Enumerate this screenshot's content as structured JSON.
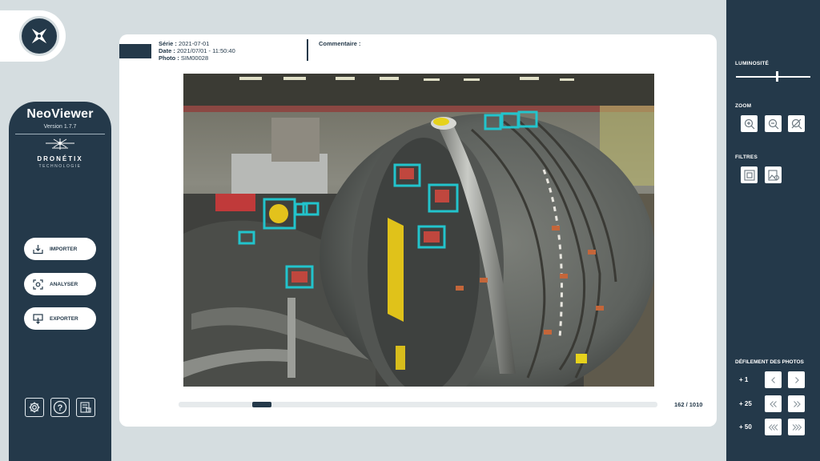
{
  "app": {
    "name": "NeoViewer",
    "version": "Version 1.7.7",
    "brand": "DRONÉTIX",
    "brand_sub": "TECHNOLOGIE"
  },
  "sidebar": {
    "buttons": [
      {
        "label": "IMPORTER",
        "icon": "import-icon"
      },
      {
        "label": "ANALYSER",
        "icon": "scan-icon"
      },
      {
        "label": "EXPORTER",
        "icon": "export-icon"
      }
    ],
    "utility_icons": [
      "settings-icon",
      "help-icon",
      "report-icon"
    ]
  },
  "photo_info": {
    "serie_label": "Série :",
    "serie_value": "2021-07-01",
    "date_label": "Date :",
    "date_value": "2021/07/01 - 11:50:40",
    "photo_label": "Photo :",
    "photo_value": "SIM00028",
    "comment_label": "Commentaire :"
  },
  "viewer": {
    "counter": "162 / 1010",
    "current": 162,
    "total": 1010,
    "detection_color": "#22c4cc",
    "detections_count": 11
  },
  "right_panel": {
    "luminosity_label": "LUMINOSITÉ",
    "luminosity_level": 0.54,
    "zoom_label": "ZOOM",
    "zoom_icons": [
      "zoom-in-icon",
      "zoom-out-icon",
      "zoom-reset-icon"
    ],
    "filters_label": "FILTRES",
    "filter_icons": [
      "filter-frame-icon",
      "filter-image-icon"
    ],
    "scroll_label": "DÉFILEMENT DES PHOTOS",
    "steps": [
      "+ 1",
      "+ 25",
      "+ 50"
    ]
  },
  "colors": {
    "navy": "#24394a",
    "background": "#d5dde0",
    "card": "#ffffff"
  }
}
